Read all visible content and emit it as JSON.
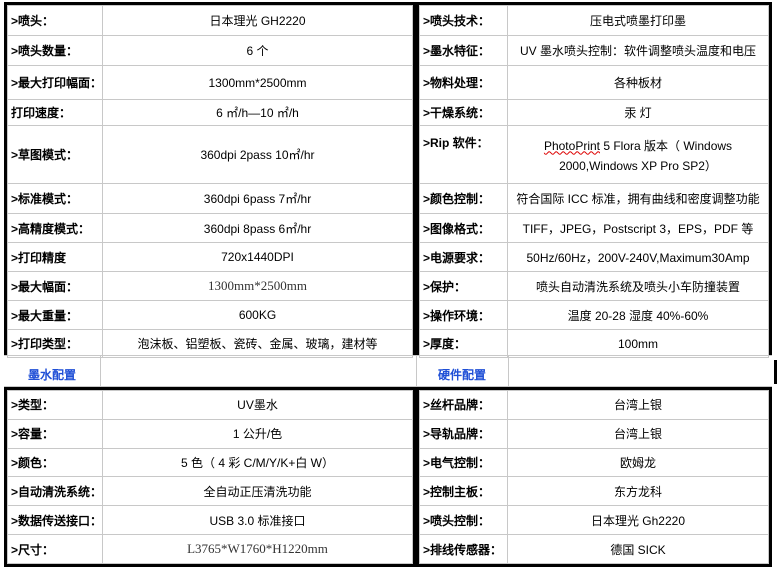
{
  "upper_left": [
    {
      "label": ">喷头：",
      "value": "日本理光 GH2220"
    },
    {
      "label": ">喷头数量：",
      "value": "6 个"
    },
    {
      "label": ">最大打印幅面：",
      "value": "1300mm*2500mm"
    },
    {
      "label": "打印速度：",
      "value": "6 ㎡/h—10 ㎡/h"
    },
    {
      "label": ">草图模式：",
      "value": "360dpi 2pass 10㎡/hr"
    },
    {
      "label": ">标准模式：",
      "value": "360dpi 6pass 7㎡/hr"
    },
    {
      "label": ">高精度模式：",
      "value": "360dpi 8pass 6㎡/hr"
    },
    {
      "label": ">打印精度",
      "value": "720x1440DPI"
    },
    {
      "label": ">最大幅面：",
      "value": "1300mm*2500mm"
    },
    {
      "label": ">最大重量：",
      "value": "600KG"
    },
    {
      "label": ">打印类型：",
      "value": "泡沫板、铝塑板、瓷砖、金属、玻璃，建材等"
    }
  ],
  "upper_right": [
    {
      "label": ">喷头技术：",
      "value": "压电式喷墨打印墨"
    },
    {
      "label": ">墨水特征：",
      "value": "UV 墨水喷头控制：软件调整喷头温度和电压"
    },
    {
      "label": ">物料处理：",
      "value": "各种板材"
    },
    {
      "label": ">干燥系统：",
      "value": "汞 灯"
    },
    {
      "label": ">Rip 软件：",
      "value_app": "PhotoPrint",
      "value": " 5 Flora 版本（ Windows 2000,Windows XP Pro SP2）"
    },
    {
      "label": ">颜色控制：",
      "value": "符合国际 ICC 标准，拥有曲线和密度调整功能"
    },
    {
      "label": ">图像格式：",
      "value": "TIFF，JPEG，Postscript 3，EPS，PDF 等"
    },
    {
      "label": ">电源要求：",
      "value": "50Hz/60Hz，200V-240V,Maximum30Amp"
    },
    {
      "label": ">保护：",
      "value": "喷头自动清洗系统及喷头小车防撞装置"
    },
    {
      "label": ">操作环境：",
      "value": "温度 20-28 湿度 40%-60%"
    },
    {
      "label": ">厚度：",
      "value": "100mm"
    }
  ],
  "sections": {
    "ink": "墨水配置",
    "hardware": "硬件配置"
  },
  "lower_left": [
    {
      "label": ">类型：",
      "value": "UV墨水"
    },
    {
      "label": ">容量：",
      "value": "1 公升/色"
    },
    {
      "label": ">颜色：",
      "value": "5 色（ 4 彩 C/M/Y/K+白 W）"
    },
    {
      "label": ">自动清洗系统：",
      "value": "全自动正压清洗功能"
    },
    {
      "label": ">数据传送接口：",
      "value": "USB 3.0 标准接口"
    },
    {
      "label": ">尺寸：",
      "value": "L3765*W1760*H1220mm"
    }
  ],
  "lower_right": [
    {
      "label": ">丝杆品牌：",
      "value": "台湾上银"
    },
    {
      "label": ">导轨品牌：",
      "value": "台湾上银"
    },
    {
      "label": ">电气控制：",
      "value": "欧姆龙"
    },
    {
      "label": ">控制主板：",
      "value": "东方龙科"
    },
    {
      "label": ">喷头控制：",
      "value": "日本理光 Gh2220"
    },
    {
      "label": ">排线传感器：",
      "value": "德国 SICK"
    }
  ],
  "colors": {
    "section_title": "#1f4fd6",
    "border": "#000000",
    "grid": "#c8c8c8",
    "spell_underline": "#dd0000"
  }
}
